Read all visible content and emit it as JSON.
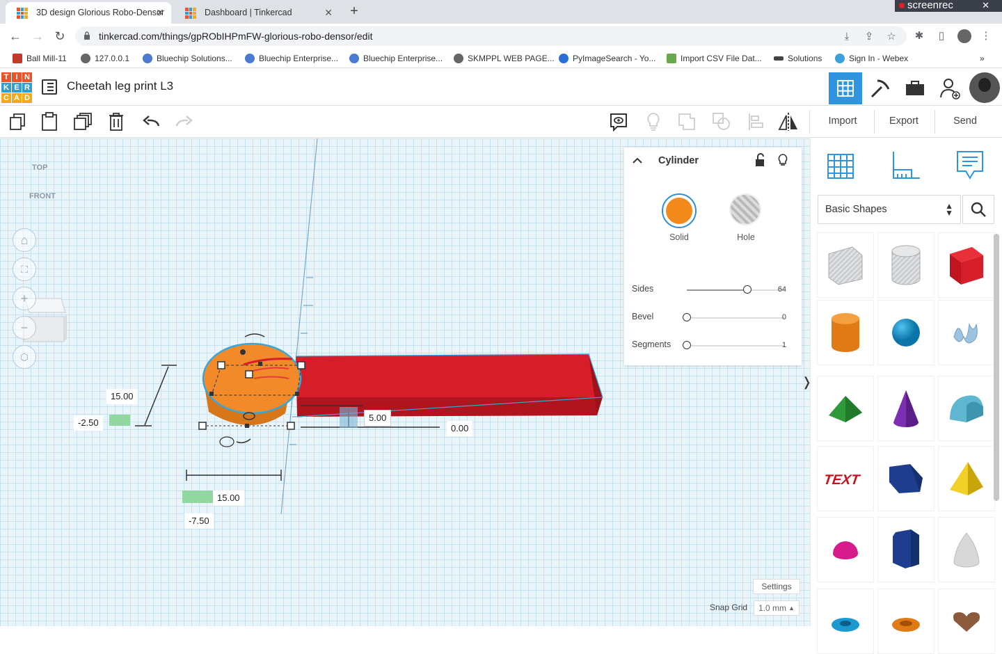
{
  "browser": {
    "tabs": [
      {
        "title": "3D design Glorious Robo-Densor",
        "active": true
      },
      {
        "title": "Dashboard | Tinkercad",
        "active": false
      }
    ],
    "new_tab": "+",
    "recorder": "screenrec",
    "url": "tinkercad.com/things/gpRObIHPmFW-glorious-robo-densor/edit",
    "bookmarks": [
      "Ball Mill-11",
      "127.0.0.1",
      "Bluechip Solutions...",
      "Bluechip Enterprise...",
      "Bluechip Enterprise...",
      "SKMPPL WEB PAGE...",
      "PyImageSearch - Yo...",
      "Import CSV File Dat...",
      "Solutions",
      "Sign In - Webex"
    ],
    "more_bookmarks": "»"
  },
  "app": {
    "logo_letters": [
      "T",
      "I",
      "N",
      "K",
      "E",
      "R",
      "C",
      "A",
      "D"
    ],
    "logo_colors": [
      "#e8542c",
      "#e8542c",
      "#e8542c",
      "#2f9fd0",
      "#2f9fd0",
      "#2f9fd0",
      "#f2a91a",
      "#f2a91a",
      "#f2a91a"
    ],
    "design_title": "Cheetah leg print L3",
    "toolbar": {
      "import": "Import",
      "export": "Export",
      "send_to": "Send To"
    },
    "accent_color": "#2f95de"
  },
  "viewcube": {
    "top": "TOP",
    "front": "FRONT"
  },
  "dimensions": {
    "height": "15.00",
    "offset_left": "-2.50",
    "elevation": "5.00",
    "zero": "0.00",
    "width": "15.00",
    "offset_bottom": "-7.50"
  },
  "inspector": {
    "title": "Cylinder",
    "solid_label": "Solid",
    "hole_label": "Hole",
    "solid_color": "#f28a1c",
    "props": [
      {
        "name": "Sides",
        "value": "64",
        "fraction": 0.62
      },
      {
        "name": "Bevel",
        "value": "0",
        "fraction": 0
      },
      {
        "name": "Segments",
        "value": "1",
        "fraction": 0
      }
    ]
  },
  "library": {
    "category": "Basic Shapes",
    "shapes": [
      "box-hole",
      "cylinder-hole",
      "box",
      "cylinder",
      "sphere",
      "scribble",
      "roof",
      "cone",
      "round-roof",
      "text",
      "wedge",
      "pyramid",
      "half-sphere",
      "polygon",
      "paraboloid",
      "torus",
      "tube",
      "heart"
    ]
  },
  "footer": {
    "settings": "Settings",
    "snap_grid_label": "Snap Grid",
    "snap_grid_value": "1.0 mm"
  }
}
